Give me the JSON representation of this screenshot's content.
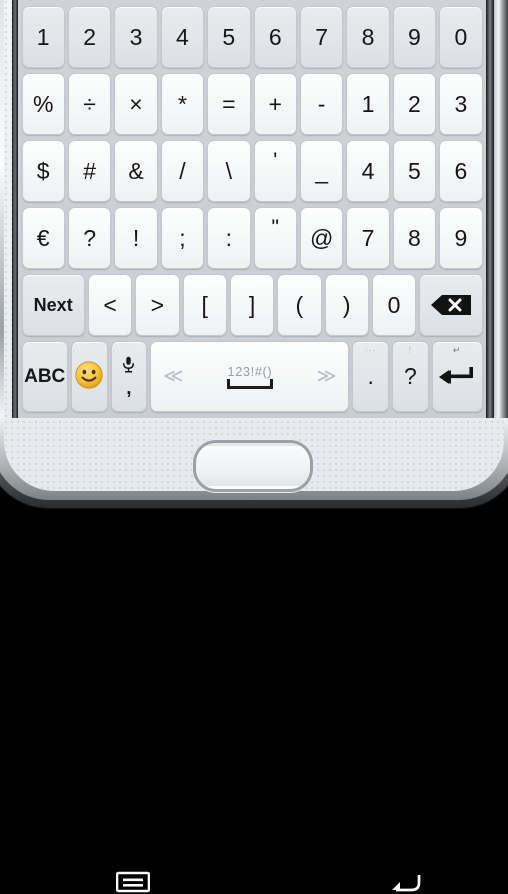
{
  "device": {
    "type": "samsung-galaxy-phone",
    "nav": {
      "menu_icon": "menu-icon",
      "home_button": "home-button",
      "back_icon": "back-icon"
    }
  },
  "keyboard": {
    "name": "samsung-symbol-keyboard",
    "colors": {
      "background": "#cfd3d8",
      "key_face": "#f7f8f9",
      "key_face_gray": "#e4e6ea",
      "key_border": "#c4c8cd",
      "key_text": "#161616",
      "hint_text": "#9aa0a6",
      "emoji_yellow": "#f9c63c"
    },
    "rows": [
      {
        "id": "row-digits",
        "style": "gray",
        "keys": [
          {
            "label": "1",
            "name": "key-1"
          },
          {
            "label": "2",
            "name": "key-2"
          },
          {
            "label": "3",
            "name": "key-3"
          },
          {
            "label": "4",
            "name": "key-4"
          },
          {
            "label": "5",
            "name": "key-5"
          },
          {
            "label": "6",
            "name": "key-6"
          },
          {
            "label": "7",
            "name": "key-7"
          },
          {
            "label": "8",
            "name": "key-8"
          },
          {
            "label": "9",
            "name": "key-9"
          },
          {
            "label": "0",
            "name": "key-0"
          }
        ]
      },
      {
        "id": "row-math",
        "style": "white",
        "keys": [
          {
            "label": "%",
            "name": "key-percent"
          },
          {
            "label": "÷",
            "name": "key-divide"
          },
          {
            "label": "×",
            "name": "key-multiply"
          },
          {
            "label": "*",
            "name": "key-asterisk"
          },
          {
            "label": "=",
            "name": "key-equals"
          },
          {
            "label": "+",
            "name": "key-plus"
          },
          {
            "label": "-",
            "name": "key-minus"
          },
          {
            "label": "1",
            "name": "key-num-1"
          },
          {
            "label": "2",
            "name": "key-num-2"
          },
          {
            "label": "3",
            "name": "key-num-3"
          }
        ]
      },
      {
        "id": "row-symbols-1",
        "style": "white",
        "keys": [
          {
            "label": "$",
            "name": "key-dollar"
          },
          {
            "label": "#",
            "name": "key-hash"
          },
          {
            "label": "&",
            "name": "key-ampersand"
          },
          {
            "label": "/",
            "name": "key-slash"
          },
          {
            "label": "\\",
            "name": "key-backslash"
          },
          {
            "label": "'",
            "name": "key-apostrophe",
            "raise": true
          },
          {
            "label": "_",
            "name": "key-underscore"
          },
          {
            "label": "4",
            "name": "key-num-4"
          },
          {
            "label": "5",
            "name": "key-num-5"
          },
          {
            "label": "6",
            "name": "key-num-6"
          }
        ]
      },
      {
        "id": "row-symbols-2",
        "style": "white",
        "keys": [
          {
            "label": "€",
            "name": "key-euro"
          },
          {
            "label": "?",
            "name": "key-question"
          },
          {
            "label": "!",
            "name": "key-exclamation"
          },
          {
            "label": ";",
            "name": "key-semicolon"
          },
          {
            "label": ":",
            "name": "key-colon"
          },
          {
            "label": "\"",
            "name": "key-quote",
            "raise": true
          },
          {
            "label": "@",
            "name": "key-at"
          },
          {
            "label": "7",
            "name": "key-num-7"
          },
          {
            "label": "8",
            "name": "key-num-8"
          },
          {
            "label": "9",
            "name": "key-num-9"
          }
        ]
      },
      {
        "id": "row-brackets",
        "style": "white",
        "keys": [
          {
            "label": "Next",
            "name": "key-next",
            "style": "gray",
            "bold": true,
            "wide": 1.45
          },
          {
            "label": "<",
            "name": "key-less-than"
          },
          {
            "label": ">",
            "name": "key-greater-than"
          },
          {
            "label": "[",
            "name": "key-bracket-open"
          },
          {
            "label": "]",
            "name": "key-bracket-close"
          },
          {
            "label": "(",
            "name": "key-paren-open"
          },
          {
            "label": ")",
            "name": "key-paren-close"
          },
          {
            "label": "0",
            "name": "key-zero"
          },
          {
            "label": "",
            "name": "key-backspace",
            "icon": "backspace-icon",
            "style": "gray",
            "wide": 1.45
          }
        ]
      },
      {
        "id": "row-bottom",
        "style": "mixed",
        "keys": [
          {
            "label": "ABC",
            "name": "key-abc",
            "style": "gray",
            "bold": true,
            "wide": 1.0
          },
          {
            "label": "",
            "name": "key-emoji",
            "icon": "smiley-icon",
            "style": "gray",
            "wide": 0.78
          },
          {
            "label": ",",
            "name": "key-comma",
            "icon": "microphone-icon",
            "style": "gray",
            "wide": 0.78
          },
          {
            "label": "123!#()",
            "name": "key-space",
            "icon": "space-icon",
            "style": "white",
            "wide": 3.9,
            "left_chevron": "≪",
            "right_chevron": "≫"
          },
          {
            "label": ".",
            "name": "key-period",
            "style": "gray",
            "wide": 0.78,
            "mini": "···"
          },
          {
            "label": "?",
            "name": "key-question-bottom",
            "style": "gray",
            "wide": 0.78,
            "mini": "!"
          },
          {
            "label": "",
            "name": "key-enter",
            "icon": "enter-icon",
            "style": "gray",
            "wide": 1.1,
            "mini": "↵"
          }
        ]
      }
    ]
  }
}
